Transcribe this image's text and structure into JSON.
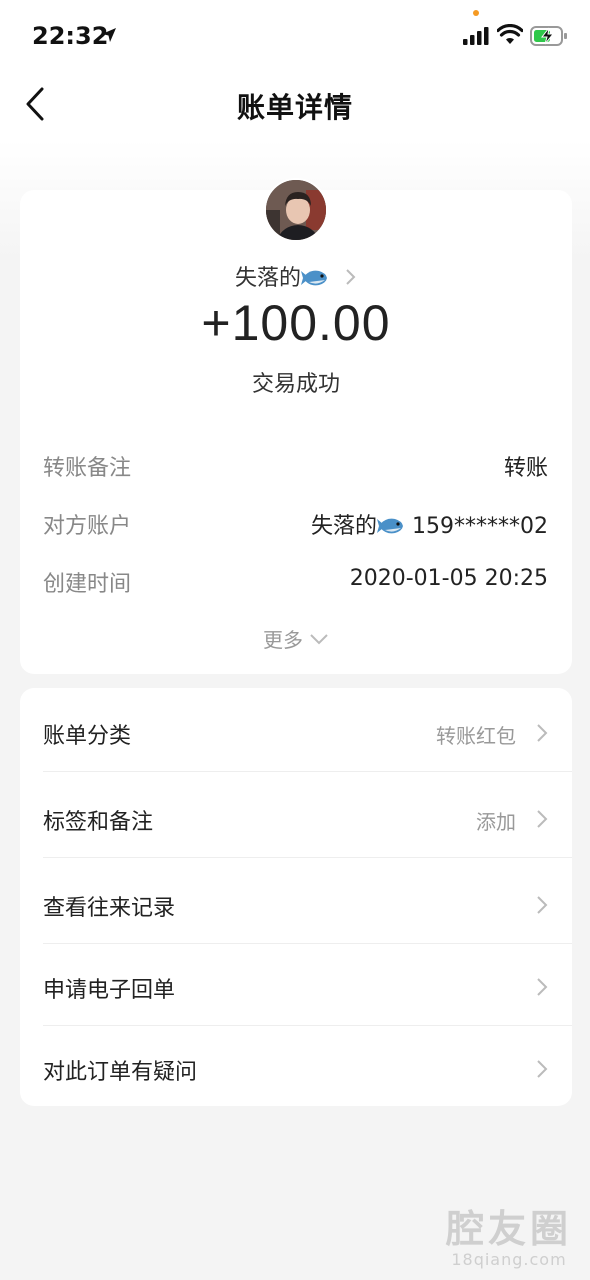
{
  "status_bar": {
    "time": "22:32"
  },
  "nav": {
    "title": "账单详情"
  },
  "summary": {
    "payer_name": "失落的",
    "amount": "+100.00",
    "status": "交易成功",
    "rows": [
      {
        "label": "转账备注",
        "value": "转账"
      },
      {
        "label": "对方账户",
        "value_name": "失落的",
        "value_account": "159******02"
      },
      {
        "label": "创建时间",
        "value": "2020-01-05 20:25"
      }
    ],
    "more": "更多"
  },
  "menu": [
    {
      "label": "账单分类",
      "value": "转账红包"
    },
    {
      "label": "标签和备注",
      "value": "添加"
    },
    {
      "label": "查看往来记录",
      "value": ""
    },
    {
      "label": "申请电子回单",
      "value": ""
    },
    {
      "label": "对此订单有疑问",
      "value": ""
    }
  ],
  "watermark": {
    "brand": "腔友圈",
    "domain": "18qiang.com"
  },
  "colors": {
    "accent_orange": "#f59a23",
    "battery_green": "#2fc84a",
    "muted_text": "#999999"
  }
}
